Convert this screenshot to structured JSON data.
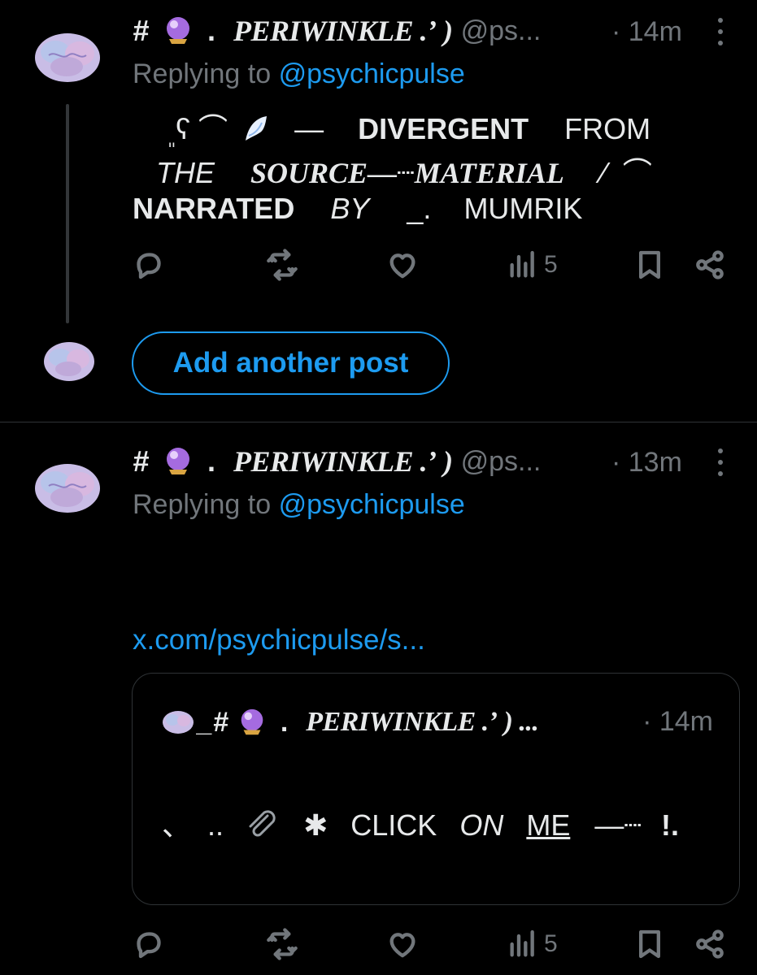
{
  "posts": [
    {
      "hash": "#",
      "name_dot": ".",
      "name": "PERIWINKLE .ʼ )",
      "handle": "@ps...",
      "time": "· 14m",
      "replying_prefix": "Replying to",
      "replying_handle": "@psychicpulse",
      "body_lines": [
        [
          "ܸ",
          "ʕ ⌒",
          "🪽",
          "—",
          "DIVERGENT",
          "FROM"
        ],
        [
          "THE",
          "SOURCE—┈MATERIAL",
          "⁄",
          "⌒"
        ],
        [
          "NARRATED",
          "BY",
          "_.",
          "MUMRIK"
        ]
      ],
      "stats": {
        "views": "5"
      }
    },
    {
      "hash": "#",
      "name_dot": ".",
      "name": "PERIWINKLE .ʼ )",
      "handle": "@ps...",
      "time": "· 13m",
      "replying_prefix": "Replying to",
      "replying_handle": "@psychicpulse",
      "link": "x.com/psychicpulse/s...",
      "quote": {
        "hash": "_#",
        "name_dot": ".",
        "name": "PERIWINKLE .ʼ ) ...",
        "time": "· 14m",
        "body": [
          "、",
          "..",
          "📎",
          "✱",
          "CLICK",
          "ON",
          "ME",
          "—┈",
          "!."
        ]
      },
      "stats": {
        "views": "5"
      }
    }
  ],
  "composer": {
    "add_post_label": "Add another post"
  },
  "icons": {
    "reply": "reply-icon",
    "repost": "repost-icon",
    "like": "heart-icon",
    "views": "views-icon",
    "bookmark": "bookmark-icon",
    "share": "share-icon",
    "more": "more-options-icon",
    "crystal_ball": "crystal-ball-emoji",
    "wing": "wing-emoji",
    "paperclip": "paperclip-emoji"
  },
  "colors": {
    "background": "#000000",
    "text": "#e7e9ea",
    "muted": "#71767b",
    "accent": "#1d9bf0",
    "border": "#2f3336"
  }
}
